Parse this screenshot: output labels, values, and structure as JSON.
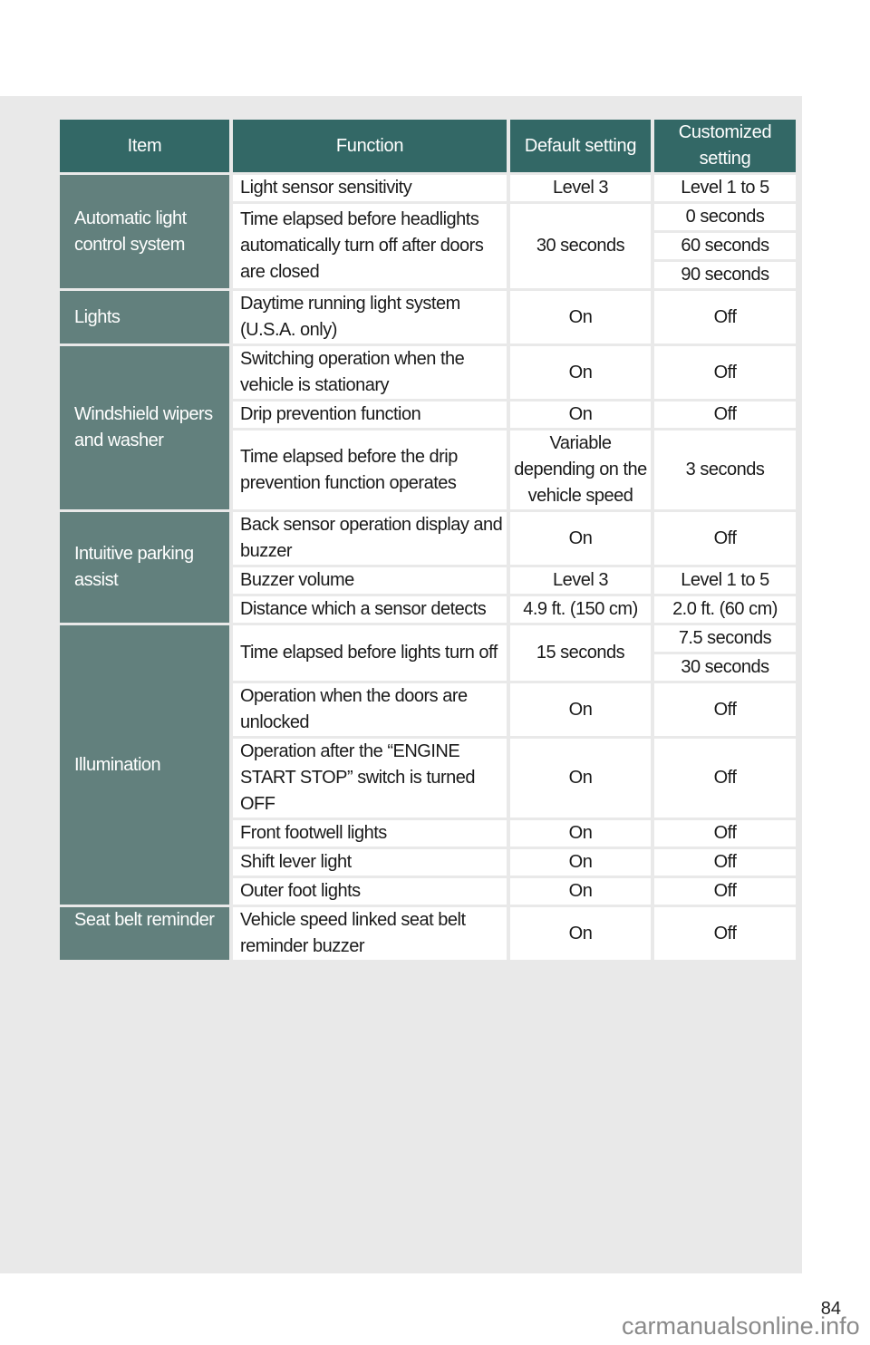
{
  "table": {
    "headers": {
      "item": "Item",
      "function": "Function",
      "default": "Default setting",
      "customized": "Customized setting"
    },
    "groups": [
      {
        "item": "Automatic light control system",
        "rows": [
          {
            "function": "Light sensor sensitivity",
            "default": "Level 3",
            "customized": [
              "Level 1 to 5"
            ]
          },
          {
            "function": "Time elapsed before headlights automatically turn off after doors are closed",
            "default": "30 seconds",
            "customized": [
              "0 seconds",
              "60 seconds",
              "90 seconds"
            ]
          }
        ]
      },
      {
        "item": "Lights",
        "rows": [
          {
            "function": "Daytime running light system (U.S.A. only)",
            "default": "On",
            "customized": [
              "Off"
            ]
          }
        ]
      },
      {
        "item": "Windshield wipers and washer",
        "rows": [
          {
            "function": "Switching operation when the vehicle is stationary",
            "default": "On",
            "customized": [
              "Off"
            ]
          },
          {
            "function": "Drip prevention function",
            "default": "On",
            "customized": [
              "Off"
            ]
          },
          {
            "function": "Time elapsed before the drip prevention function operates",
            "default": "Variable depending on the vehicle speed",
            "customized": [
              "3 seconds"
            ]
          }
        ]
      },
      {
        "item": "Intuitive parking assist",
        "rows": [
          {
            "function": "Back sensor operation display and buzzer",
            "default": "On",
            "customized": [
              "Off"
            ]
          },
          {
            "function": "Buzzer volume",
            "default": "Level 3",
            "customized": [
              "Level 1 to 5"
            ]
          },
          {
            "function": "Distance which a sensor detects",
            "default": "4.9 ft. (150 cm)",
            "customized": [
              "2.0 ft. (60 cm)"
            ]
          }
        ]
      },
      {
        "item": "Illumination",
        "rows": [
          {
            "function": "Time elapsed before lights turn off",
            "default": "15 seconds",
            "customized": [
              "7.5 seconds",
              "30 seconds"
            ]
          },
          {
            "function": "Operation when the doors are unlocked",
            "default": "On",
            "customized": [
              "Off"
            ]
          },
          {
            "function": "Operation after the “ENGINE START STOP” switch is turned OFF",
            "default": "On",
            "customized": [
              "Off"
            ]
          },
          {
            "function": "Front footwell lights",
            "default": "On",
            "customized": [
              "Off"
            ]
          },
          {
            "function": "Shift lever light",
            "default": "On",
            "customized": [
              "Off"
            ]
          },
          {
            "function": "Outer foot lights",
            "default": "On",
            "customized": [
              "Off"
            ]
          }
        ]
      },
      {
        "item": "Seat belt reminder",
        "rows": [
          {
            "function": "Vehicle speed linked seat belt reminder buzzer",
            "default": "On",
            "customized": [
              "Off"
            ]
          }
        ]
      }
    ]
  },
  "footer": {
    "page_number": "84",
    "watermark": "carmanualsonline.info"
  }
}
